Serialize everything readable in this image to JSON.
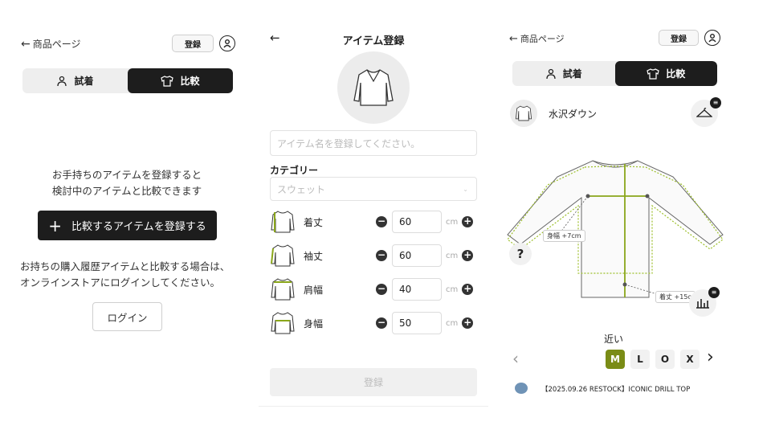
{
  "panel1": {
    "back_label": "商品ページ",
    "register_label": "登録",
    "tabs": [
      {
        "label": "試着",
        "icon": "person-icon"
      },
      {
        "label": "比較",
        "icon": "shirt-icon",
        "active": true
      }
    ],
    "message_line1": "お手持ちのアイテムを登録すると",
    "message_line2": "検討中のアイテムと比較できます",
    "add_button_label": "比較するアイテムを登録する",
    "login_note_line1": "お持ちの購入履歴アイテムと比較する場合は、",
    "login_note_line2": "オンラインストアにログインしてください。",
    "login_button_label": "ログイン"
  },
  "panel2": {
    "title": "アイテム登録",
    "name_placeholder": "アイテム名を登録してください。",
    "category_label": "カテゴリー",
    "category_value": "スウェット",
    "measurements": [
      {
        "label": "着丈",
        "value": "60",
        "unit": "cm"
      },
      {
        "label": "袖丈",
        "value": "60",
        "unit": "cm"
      },
      {
        "label": "肩幅",
        "value": "40",
        "unit": "cm"
      },
      {
        "label": "身幅",
        "value": "50",
        "unit": "cm"
      }
    ],
    "submit_label": "登録"
  },
  "panel3": {
    "back_label": "商品ページ",
    "register_label": "登録",
    "tabs": [
      {
        "label": "試着",
        "icon": "person-icon"
      },
      {
        "label": "比較",
        "icon": "shirt-icon",
        "active": true
      }
    ],
    "item_name": "水沢ダウン",
    "help_symbol": "?",
    "tag_width": "身幅 +7cm",
    "tag_length": "着丈 +15c",
    "fit_label": "近い",
    "sizes": [
      "M",
      "L",
      "O",
      "X"
    ],
    "selected_size": "M",
    "product_name": "【2025.09.26 RESTOCK】ICONIC DRILL TOP",
    "colors": {
      "accent": "#8aa61a",
      "dark": "#1d1d1d"
    }
  }
}
